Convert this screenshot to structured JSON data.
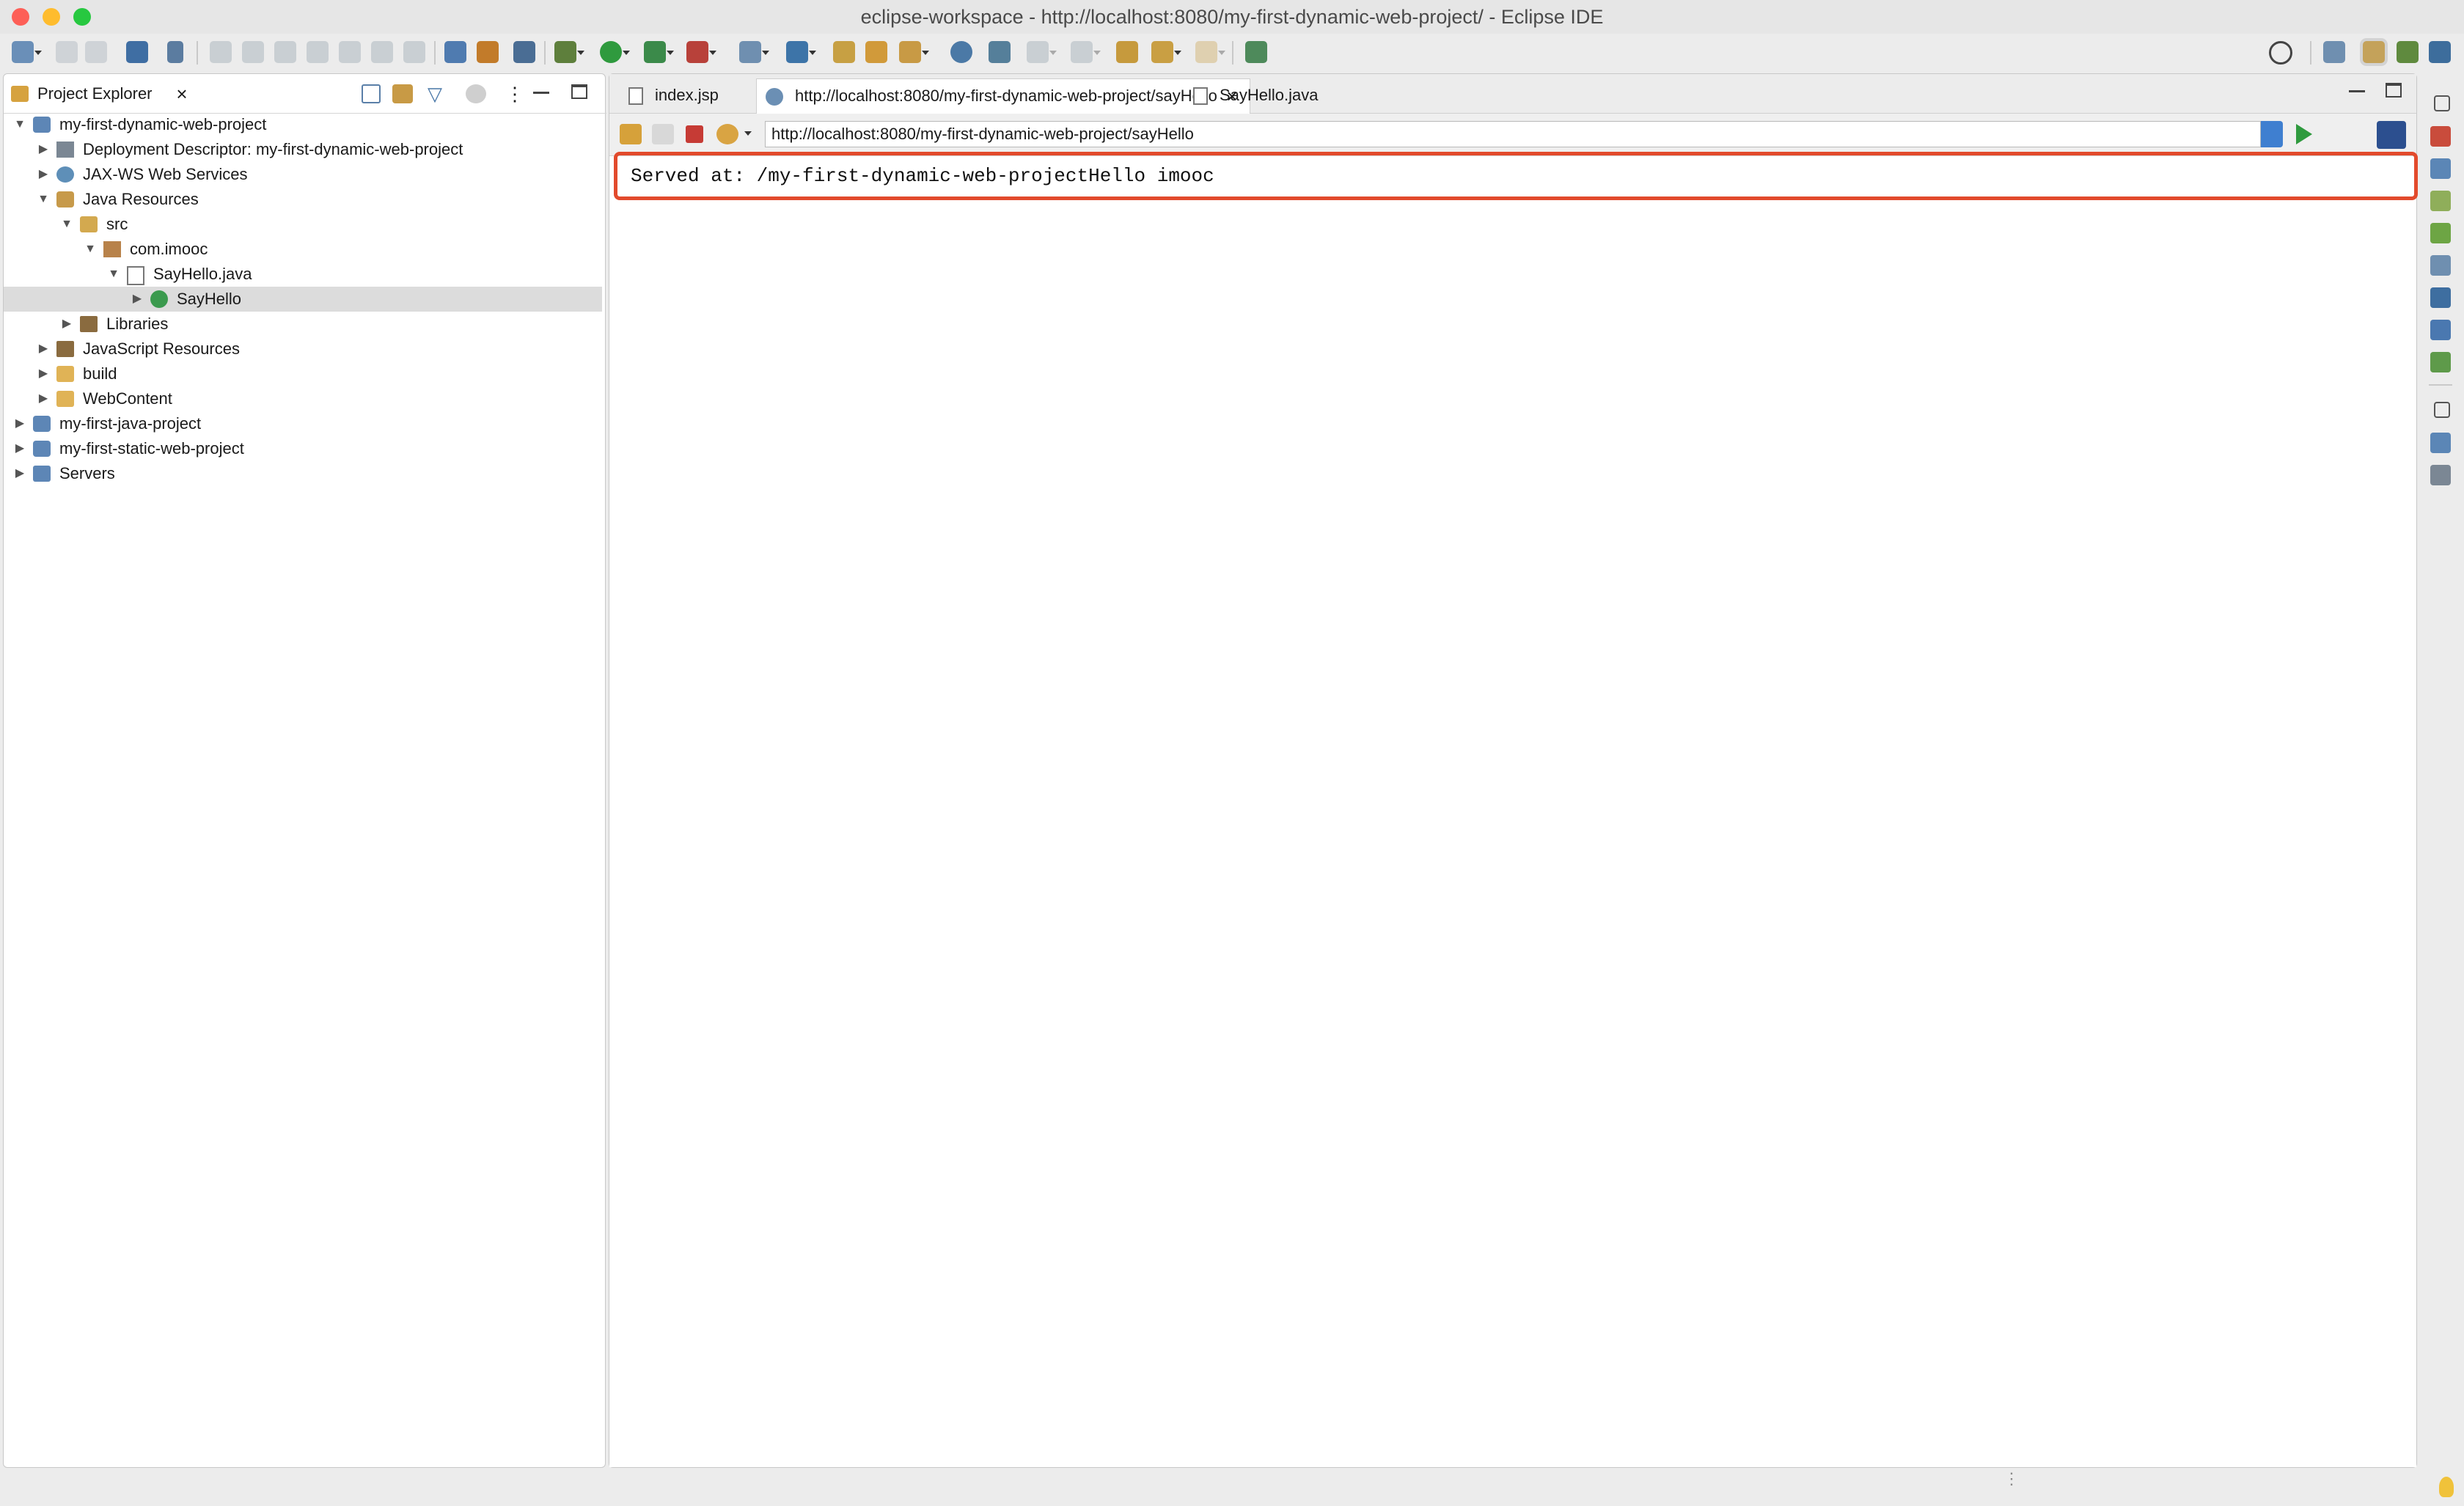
{
  "window": {
    "title": "eclipse-workspace - http://localhost:8080/my-first-dynamic-web-project/ - Eclipse IDE",
    "traffic_colors": [
      "#fd5f57",
      "#febc2e",
      "#27c840"
    ]
  },
  "left_panel": {
    "tab_label": "Project Explorer",
    "tree": [
      {
        "label": "my-first-dynamic-web-project",
        "icon": "web-project-icon",
        "twisty": "▼"
      },
      {
        "label": "Deployment Descriptor: my-first-dynamic-web-project",
        "icon": "deployment-descriptor-icon",
        "twisty": "▶"
      },
      {
        "label": "JAX-WS Web Services",
        "icon": "web-services-icon",
        "twisty": "▶"
      },
      {
        "label": "Java Resources",
        "icon": "java-resources-icon",
        "twisty": "▼"
      },
      {
        "label": "src",
        "icon": "source-folder-icon",
        "twisty": "▼"
      },
      {
        "label": "com.imooc",
        "icon": "package-icon",
        "twisty": "▼"
      },
      {
        "label": "SayHello.java",
        "icon": "java-file-icon",
        "twisty": "▼"
      },
      {
        "label": "SayHello",
        "icon": "java-class-icon",
        "twisty": "▶"
      },
      {
        "label": "Libraries",
        "icon": "libraries-icon",
        "twisty": "▶"
      },
      {
        "label": "JavaScript Resources",
        "icon": "javascript-resources-icon",
        "twisty": "▶"
      },
      {
        "label": "build",
        "icon": "folder-icon",
        "twisty": "▶"
      },
      {
        "label": "WebContent",
        "icon": "folder-icon",
        "twisty": "▶"
      },
      {
        "label": "my-first-java-project",
        "icon": "java-project-icon",
        "twisty": "▶"
      },
      {
        "label": "my-first-static-web-project",
        "icon": "web-project-icon",
        "twisty": "▶"
      },
      {
        "label": "Servers",
        "icon": "servers-folder-icon",
        "twisty": "▶"
      }
    ]
  },
  "editor": {
    "tabs": [
      {
        "label": "index.jsp",
        "icon": "jsp-file-icon"
      },
      {
        "label": "http://localhost:8080/my-first-dynamic-web-project/sayHello",
        "icon": "globe-icon",
        "active": true
      },
      {
        "label": "SayHello.java",
        "icon": "java-file-icon"
      }
    ],
    "url": "http://localhost:8080/my-first-dynamic-web-project/sayHello",
    "page_content": "Served at: /my-first-dynamic-web-projectHello imooc",
    "highlight_color": "#e24a2c"
  }
}
